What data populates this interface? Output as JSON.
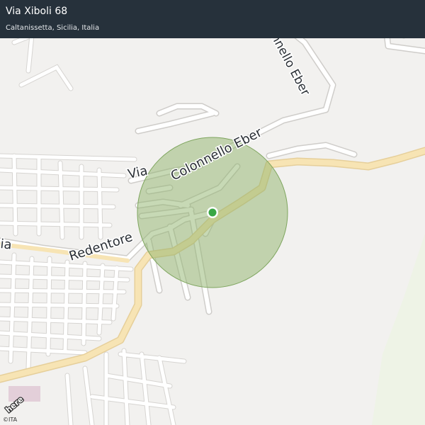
{
  "header": {
    "title": "Via Xiboli 68",
    "subtitle": "Caltanissetta, Sicilia, Italia"
  },
  "map": {
    "street_labels": {
      "colonnello_eber_vertical": "Colonnello Eber",
      "via": "Via",
      "colonnello_eber": "Colonnello Eber",
      "redentore": "Redentore",
      "left_edge_fragment": "ia"
    },
    "brand_logo_text": "here",
    "copyright": "©ITA",
    "colors": {
      "header_bg": "#26313b",
      "accuracy_circle": "#8fb36b",
      "location_dot": "#3aa745",
      "main_road": "#f7e4b4",
      "land": "#f2f1ef"
    }
  }
}
